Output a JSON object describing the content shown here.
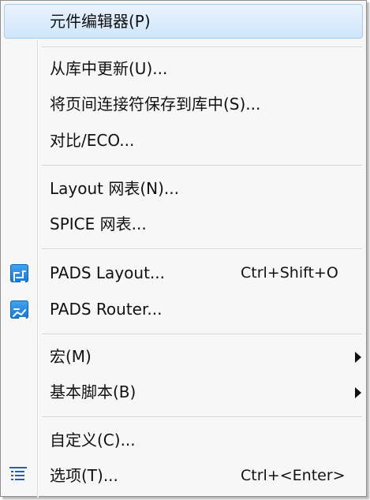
{
  "menu": {
    "items": [
      {
        "label": "元件编辑器(P)"
      },
      {
        "label": "从库中更新(U)..."
      },
      {
        "label": "将页间连接符保存到库中(S)..."
      },
      {
        "label": "对比/ECO..."
      },
      {
        "label": "Layout 网表(N)..."
      },
      {
        "label": "SPICE 网表..."
      },
      {
        "label": "PADS Layout...",
        "shortcut": "Ctrl+Shift+O"
      },
      {
        "label": "PADS Router..."
      },
      {
        "label": "宏(M)"
      },
      {
        "label": "基本脚本(B)"
      },
      {
        "label": "自定义(C)..."
      },
      {
        "label": "选项(T)...",
        "shortcut": "Ctrl+<Enter>"
      }
    ]
  },
  "icons": {
    "pads_layout": "pads-layout-icon",
    "pads_router": "pads-router-icon",
    "options": "options-list-icon"
  },
  "colors": {
    "highlight": "#d9ebfb",
    "icon_blue": "#1e88e5"
  }
}
